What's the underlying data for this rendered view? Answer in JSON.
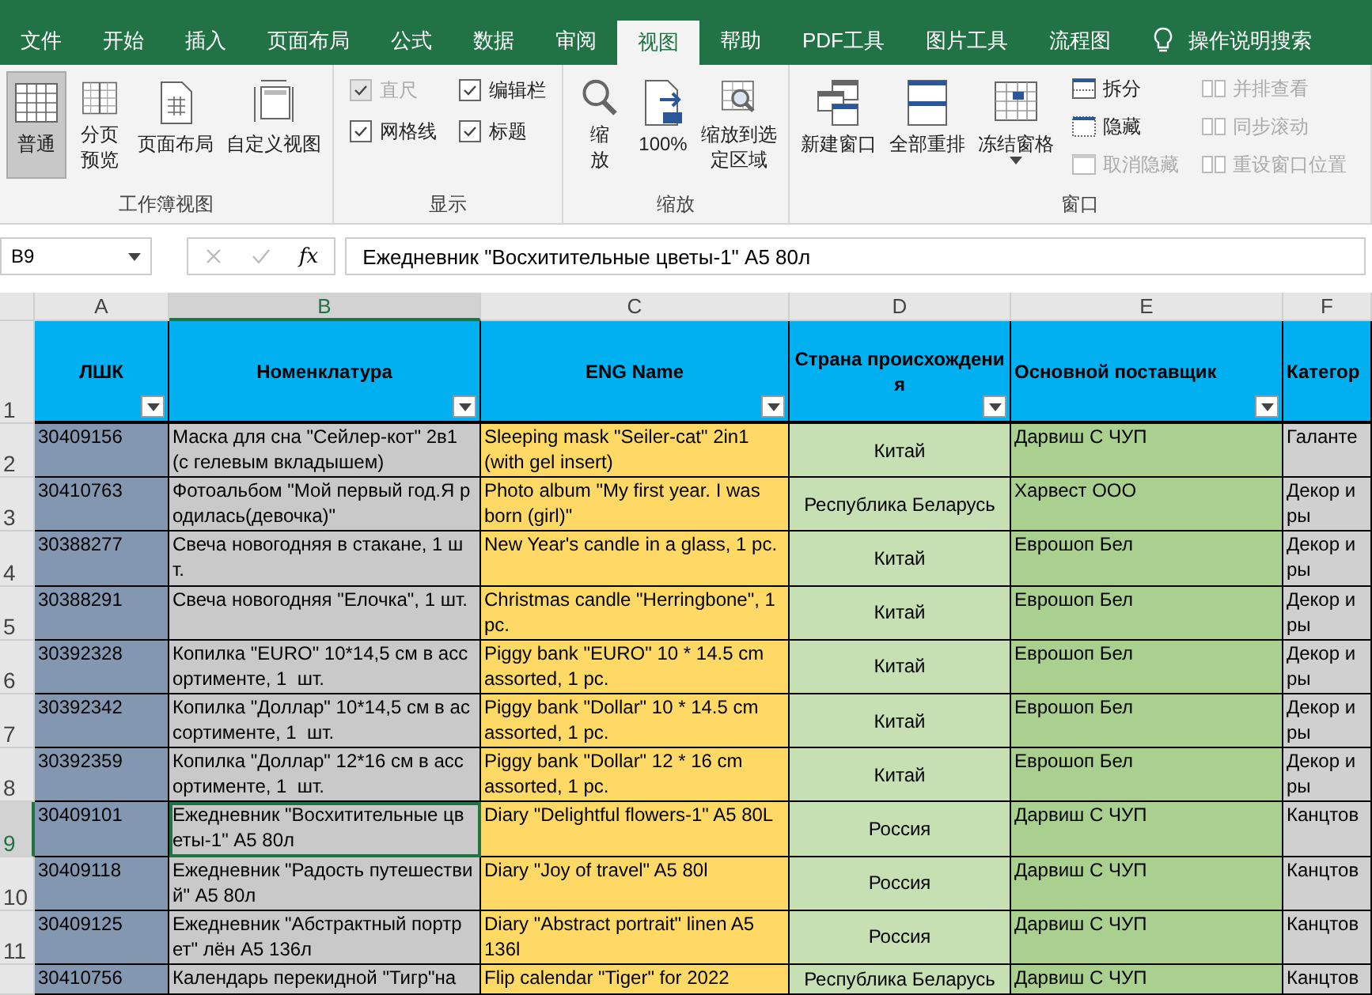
{
  "ribbon_tabs": [
    {
      "label": "文件",
      "selected": false
    },
    {
      "label": "开始",
      "selected": false
    },
    {
      "label": "插入",
      "selected": false
    },
    {
      "label": "页面布局",
      "selected": false
    },
    {
      "label": "公式",
      "selected": false
    },
    {
      "label": "数据",
      "selected": false
    },
    {
      "label": "审阅",
      "selected": false
    },
    {
      "label": "视图",
      "selected": true
    },
    {
      "label": "帮助",
      "selected": false
    },
    {
      "label": "PDF工具",
      "selected": false
    },
    {
      "label": "图片工具",
      "selected": false
    },
    {
      "label": "流程图",
      "selected": false
    }
  ],
  "tell_me": {
    "label": "操作说明搜索"
  },
  "ribbon_groups": [
    {
      "label": "工作簿视图",
      "items": [
        {
          "kind": "large",
          "label": "普通",
          "selected": true
        },
        {
          "kind": "large",
          "label": "分页预览",
          "selected": false
        },
        {
          "kind": "large",
          "label": "页面布局",
          "selected": false
        },
        {
          "kind": "large",
          "label": "自定义视图",
          "selected": false
        }
      ]
    },
    {
      "label": "显示",
      "items": [
        {
          "kind": "column",
          "items": [
            {
              "kind": "check",
              "label": "直尺",
              "checked": true,
              "disabled": true
            },
            {
              "kind": "check",
              "label": "网格线",
              "checked": true,
              "disabled": false
            }
          ]
        },
        {
          "kind": "column",
          "items": [
            {
              "kind": "check",
              "label": "编辑栏",
              "checked": true,
              "disabled": false
            },
            {
              "kind": "check",
              "label": "标题",
              "checked": true,
              "disabled": false
            }
          ]
        }
      ]
    },
    {
      "label": "缩放",
      "items": [
        {
          "kind": "large",
          "label": "缩放"
        },
        {
          "kind": "large",
          "label": "100%"
        },
        {
          "kind": "large",
          "label": "缩放到选定区域"
        }
      ]
    },
    {
      "label": "窗口",
      "items": [
        {
          "kind": "large",
          "label": "新建窗口"
        },
        {
          "kind": "large",
          "label": "全部重排"
        },
        {
          "kind": "large",
          "label": "冻结窗格",
          "dropdown": true
        },
        {
          "kind": "column",
          "items": [
            {
              "kind": "small",
              "label": "拆分",
              "disabled": false
            },
            {
              "kind": "small",
              "label": "隐藏",
              "disabled": false
            },
            {
              "kind": "small",
              "label": "取消隐藏",
              "disabled": true
            }
          ]
        },
        {
          "kind": "column",
          "items": [
            {
              "kind": "small",
              "label": "并排查看",
              "disabled": true
            },
            {
              "kind": "small",
              "label": "同步滚动",
              "disabled": true
            },
            {
              "kind": "small",
              "label": "重设窗口位置",
              "disabled": true
            }
          ]
        }
      ]
    }
  ],
  "formula_bar": {
    "name_box": "B9",
    "fx": "fx",
    "formula": "Ежедневник \"Восхитительные цветы-1\" А5 80л"
  },
  "columns": [
    {
      "label": "A",
      "selected": false
    },
    {
      "label": "B",
      "selected": true
    },
    {
      "label": "C",
      "selected": false
    },
    {
      "label": "D",
      "selected": false
    },
    {
      "label": "E",
      "selected": false
    },
    {
      "label": "F",
      "selected": false
    }
  ],
  "header_row": {
    "number": "1",
    "selected": false,
    "cells": [
      {
        "text": "ЛШК",
        "filter": true
      },
      {
        "text": "Номенклатура",
        "filter": true
      },
      {
        "text": "ENG Name",
        "filter": true
      },
      {
        "text": "Страна происхождени\nя",
        "filter": true
      },
      {
        "text": "Основной поставщик",
        "filter": true
      },
      {
        "text": "Категор",
        "filter": false
      }
    ]
  },
  "rows": [
    {
      "number": "2",
      "selected": false,
      "cells": [
        "30409156",
        "Маска для сна \"Сейлер-кот\" 2в1\n(с гелевым вкладышем)",
        "Sleeping mask \"Seiler-cat\" 2in1\n(with gel insert)",
        "Китай",
        "Дарвиш С ЧУП",
        "Галанте"
      ]
    },
    {
      "number": "3",
      "selected": false,
      "cells": [
        "30410763",
        "Фотоальбом \"Мой первый год.Я р\nодилась(девочка)\"",
        "Photo album \"My first year. I was\nborn (girl)\"",
        "Республика Беларусь",
        "Харвест ООО",
        "Декор и\nры"
      ]
    },
    {
      "number": "4",
      "selected": false,
      "cells": [
        "30388277",
        "Свеча новогодняя в стакане, 1 ш\nт.",
        "New Year's candle in a glass, 1 pc.",
        "Китай",
        "Еврошоп Бел",
        "Декор и\nры"
      ]
    },
    {
      "number": "5",
      "selected": false,
      "cells": [
        "30388291",
        "Свеча новогодняя \"Елочка\", 1 шт.",
        "Christmas candle \"Herringbone\", 1\npc.",
        "Китай",
        "Еврошоп Бел",
        "Декор и\nры"
      ]
    },
    {
      "number": "6",
      "selected": false,
      "cells": [
        "30392328",
        "Копилка \"EURO\" 10*14,5 см в асс\nортименте, 1  шт.",
        "Piggy bank \"EURO\" 10 * 14.5 cm\nassorted, 1 pc.",
        "Китай",
        "Еврошоп Бел",
        "Декор и\nры"
      ]
    },
    {
      "number": "7",
      "selected": false,
      "cells": [
        "30392342",
        "Копилка \"Доллар\" 10*14,5 см в ас\nсортименте, 1  шт.",
        "Piggy bank \"Dollar\" 10 * 14.5 cm\nassorted, 1 pc.",
        "Китай",
        "Еврошоп Бел",
        "Декор и\nры"
      ]
    },
    {
      "number": "8",
      "selected": false,
      "cells": [
        "30392359",
        "Копилка \"Доллар\" 12*16 см в асс\nортименте, 1  шт.",
        "Piggy bank \"Dollar\" 12 * 16 cm\nassorted, 1 pc.",
        "Китай",
        "Еврошоп Бел",
        "Декор и\nры"
      ]
    },
    {
      "number": "9",
      "selected": true,
      "cells": [
        "30409101",
        "Ежедневник \"Восхитительные цв\nеты-1\" А5 80л",
        "Diary \"Delightful flowers-1\" A5 80L",
        "Россия",
        "Дарвиш С ЧУП",
        "Канцтов"
      ]
    },
    {
      "number": "10",
      "selected": false,
      "cells": [
        "30409118",
        "Ежедневник \"Радость путешестви\nй\" А5 80л",
        "Diary \"Joy of travel\" A5 80l",
        "Россия",
        "Дарвиш С ЧУП",
        "Канцтов"
      ]
    },
    {
      "number": "11",
      "selected": false,
      "cells": [
        "30409125",
        "Ежедневник \"Абстрактный портр\nет\" лён А5 136л",
        "Diary \"Abstract portrait\" linen A5\n136l",
        "Россия",
        "Дарвиш С ЧУП",
        "Канцтов"
      ]
    },
    {
      "selected": false,
      "cells": [
        "30410756",
        "Календарь перекидной \"Тигр\"на",
        "Flip calendar \"Tiger\" for 2022",
        "Республика Беларусь",
        "Дарвиш С ЧУП",
        "Канцтов"
      ]
    }
  ]
}
